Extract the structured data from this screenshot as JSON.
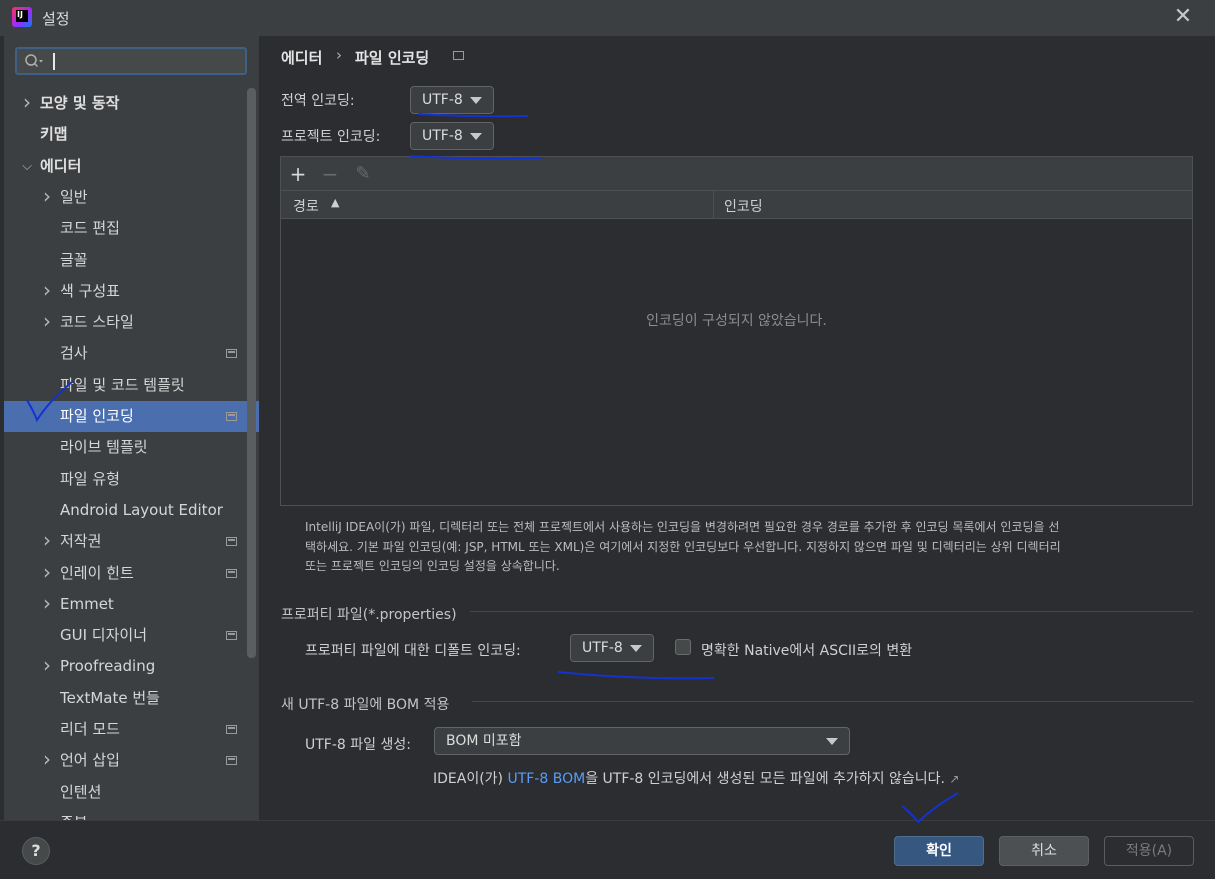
{
  "window": {
    "title": "설정"
  },
  "search": {
    "placeholder": ""
  },
  "sidebar": {
    "items": [
      {
        "label": "모양 및 동작",
        "chevron": "right",
        "level": 0,
        "bold": true
      },
      {
        "label": "키맵",
        "chevron": "",
        "level": 0,
        "bold": true
      },
      {
        "label": "에디터",
        "chevron": "down",
        "level": 0,
        "bold": true
      },
      {
        "label": "일반",
        "chevron": "right",
        "level": 1
      },
      {
        "label": "코드 편집",
        "chevron": "",
        "level": 1
      },
      {
        "label": "글꼴",
        "chevron": "",
        "level": 1
      },
      {
        "label": "색 구성표",
        "chevron": "right",
        "level": 1
      },
      {
        "label": "코드 스타일",
        "chevron": "right",
        "level": 1
      },
      {
        "label": "검사",
        "chevron": "",
        "level": 1,
        "project": true
      },
      {
        "label": "파일 및 코드 템플릿",
        "chevron": "",
        "level": 1
      },
      {
        "label": "파일 인코딩",
        "chevron": "",
        "level": 1,
        "project": true,
        "selected": true
      },
      {
        "label": "라이브 템플릿",
        "chevron": "",
        "level": 1
      },
      {
        "label": "파일 유형",
        "chevron": "",
        "level": 1
      },
      {
        "label": "Android Layout Editor",
        "chevron": "",
        "level": 1
      },
      {
        "label": "저작권",
        "chevron": "right",
        "level": 1,
        "project": true
      },
      {
        "label": "인레이 힌트",
        "chevron": "right",
        "level": 1,
        "project": true
      },
      {
        "label": "Emmet",
        "chevron": "right",
        "level": 1
      },
      {
        "label": "GUI 디자이너",
        "chevron": "",
        "level": 1,
        "project": true
      },
      {
        "label": "Proofreading",
        "chevron": "right",
        "level": 1
      },
      {
        "label": "TextMate 번들",
        "chevron": "",
        "level": 1
      },
      {
        "label": "리더 모드",
        "chevron": "",
        "level": 1,
        "project": true
      },
      {
        "label": "언어 삽입",
        "chevron": "right",
        "level": 1,
        "project": true
      },
      {
        "label": "인텐션",
        "chevron": "",
        "level": 1
      },
      {
        "label": "중복",
        "chevron": "",
        "level": 1
      }
    ]
  },
  "breadcrumb": {
    "parent": "에디터",
    "separator": "›",
    "current": "파일 인코딩"
  },
  "encoding": {
    "global_label": "전역 인코딩:",
    "global_value": "UTF-8",
    "project_label": "프로젝트 인코딩:",
    "project_value": "UTF-8"
  },
  "table": {
    "toolbar": {
      "add": "+",
      "remove": "−",
      "edit": "✎"
    },
    "columns": [
      "경로",
      "인코딩"
    ],
    "sort_indicator": "▲",
    "empty_text": "인코딩이 구성되지 않았습니다."
  },
  "description": {
    "line1": "IntelliJ IDEA이(가) 파일, 디렉터리 또는 전체 프로젝트에서 사용하는 인코딩을 변경하려면 필요한 경우 경로를 추가한 후 인코딩 목록에서 인코딩을 선",
    "line2": "택하세요. 기본 파일 인코딩(예: JSP, HTML 또는 XML)은 여기에서 지정한 인코딩보다 우선합니다. 지정하지 않으면 파일 및 디렉터리는 상위 디렉터리",
    "line3": "또는 프로젝트 인코딩의 인코딩 설정을 상속합니다."
  },
  "properties": {
    "section_title": "프로퍼티 파일(*.properties)",
    "default_label": "프로퍼티 파일에 대한 디폴트 인코딩:",
    "default_value": "UTF-8",
    "native_ascii_label": "명확한 Native에서 ASCII로의 변환",
    "native_ascii_checked": false
  },
  "bom": {
    "section_title": "새 UTF-8 파일에 BOM 적용",
    "create_label": "UTF-8 파일 생성:",
    "create_value": "BOM 미포함",
    "note_prefix": "IDEA이(가) ",
    "note_link": "UTF-8 BOM",
    "note_suffix": "을 UTF-8 인코딩에서 생성된 모든 파일에 추가하지 않습니다.",
    "note_arrow": "↗"
  },
  "footer": {
    "help": "?",
    "ok": "확인",
    "cancel": "취소",
    "apply": "적용(A)"
  },
  "colors": {
    "background": "#2b2d30",
    "panel": "#3c3f41",
    "selection": "#4b6eaf",
    "link": "#589df6",
    "primary_button": "#365880",
    "ink": "#1432d0"
  }
}
